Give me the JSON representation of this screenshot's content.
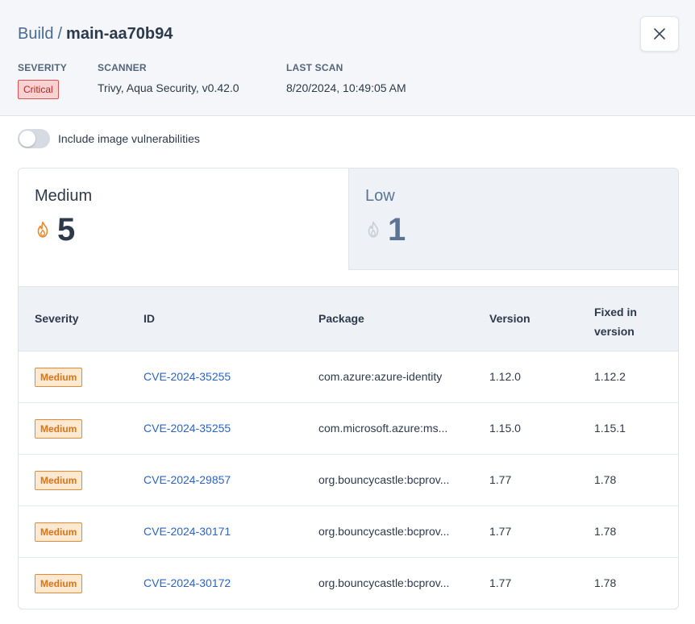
{
  "header": {
    "crumb": "Build",
    "separator": "/",
    "name": "main-aa70b94",
    "close_icon": "close-icon",
    "meta": {
      "severity_label": "SEVERITY",
      "severity_value": "Critical",
      "scanner_label": "SCANNER",
      "scanner_value": "Trivy, Aqua Security, v0.42.0",
      "last_scan_label": "LAST SCAN",
      "last_scan_value": "8/20/2024, 10:49:05 AM"
    }
  },
  "toggle": {
    "label": "Include image vulnerabilities",
    "checked": false
  },
  "tabs": [
    {
      "title": "Medium",
      "count": "5",
      "icon": "flame-icon",
      "active": true
    },
    {
      "title": "Low",
      "count": "1",
      "icon": "flame-icon",
      "active": false
    }
  ],
  "table": {
    "columns": [
      "Severity",
      "ID",
      "Package",
      "Version",
      "Fixed in version"
    ],
    "rows": [
      {
        "severity": "Medium",
        "id": "CVE-2024-35255",
        "package": "com.azure:azure-identity",
        "version": "1.12.0",
        "fixed": "1.12.2"
      },
      {
        "severity": "Medium",
        "id": "CVE-2024-35255",
        "package": "com.microsoft.azure:ms...",
        "version": "1.15.0",
        "fixed": "1.15.1"
      },
      {
        "severity": "Medium",
        "id": "CVE-2024-29857",
        "package": "org.bouncycastle:bcprov...",
        "version": "1.77",
        "fixed": "1.78"
      },
      {
        "severity": "Medium",
        "id": "CVE-2024-30171",
        "package": "org.bouncycastle:bcprov...",
        "version": "1.77",
        "fixed": "1.78"
      },
      {
        "severity": "Medium",
        "id": "CVE-2024-30172",
        "package": "org.bouncycastle:bcprov...",
        "version": "1.77",
        "fixed": "1.78"
      }
    ]
  },
  "colors": {
    "critical": "#b3261e",
    "medium": "#e8892e",
    "link": "#2c64c7",
    "low_muted": "#5a7594"
  }
}
